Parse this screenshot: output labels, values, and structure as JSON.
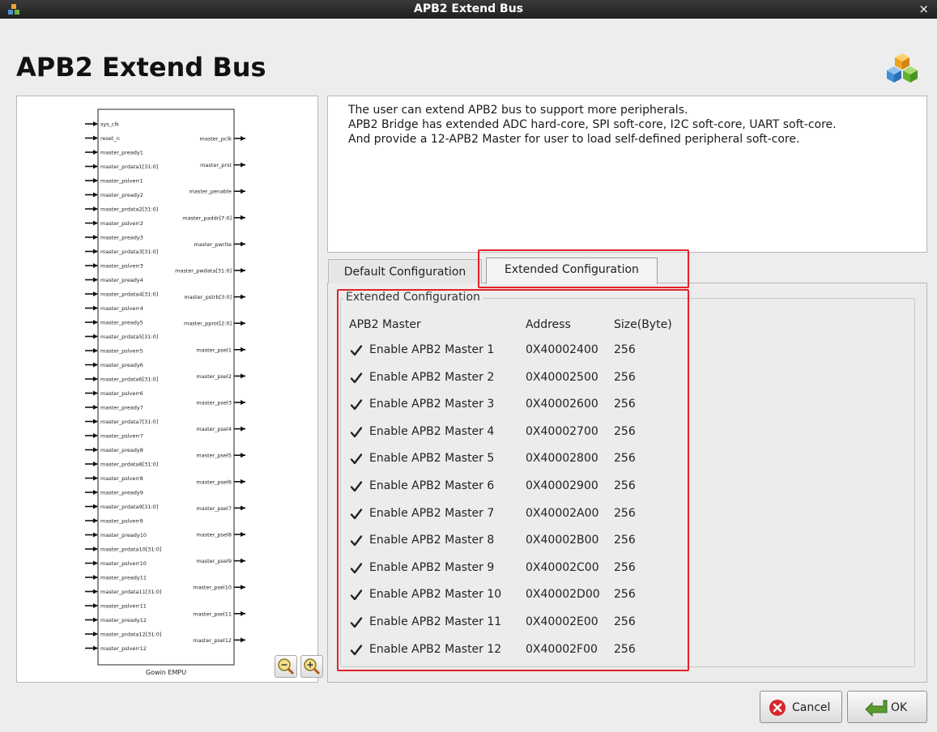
{
  "window": {
    "title": "APB2 Extend Bus",
    "close_glyph": "×"
  },
  "header": {
    "title": "APB2 Extend Bus"
  },
  "diagram": {
    "block_label": "Gowin EMPU",
    "left_pins": [
      "sys_clk",
      "reset_n",
      "master_pready1",
      "master_prdata1[31:0]",
      "master_pslverr1",
      "master_pready2",
      "master_prdata2[31:0]",
      "master_pslverr2",
      "master_pready3",
      "master_prdata3[31:0]",
      "master_pslverr3",
      "master_pready4",
      "master_prdata4[31:0]",
      "master_pslverr4",
      "master_pready5",
      "master_prdata5[31:0]",
      "master_pslverr5",
      "master_pready6",
      "master_prdata6[31:0]",
      "master_pslverr6",
      "master_pready7",
      "master_prdata7[31:0]",
      "master_pslverr7",
      "master_pready8",
      "master_prdata8[31:0]",
      "master_pslverr8",
      "master_pready9",
      "master_prdata9[31:0]",
      "master_pslverr9",
      "master_pready10",
      "master_prdata10[31:0]",
      "master_pslverr10",
      "master_pready11",
      "master_prdata11[31:0]",
      "master_pslverr11",
      "master_pready12",
      "master_prdata12[31:0]",
      "master_pslverr12"
    ],
    "right_pins": [
      "master_pclk",
      "master_prst",
      "master_penable",
      "master_paddr[7:0]",
      "master_pwrite",
      "master_pwdata[31:0]",
      "master_pstrb[3:0]",
      "master_pprot[2:0]",
      "master_psel1",
      "master_psel2",
      "master_psel3",
      "master_psel4",
      "master_psel5",
      "master_psel6",
      "master_psel7",
      "master_psel8",
      "master_psel9",
      "master_psel10",
      "master_psel11",
      "master_psel12"
    ]
  },
  "description": [
    "The user can extend APB2 bus to support more peripherals.",
    "APB2 Bridge has extended ADC hard-core, SPI soft-core, I2C soft-core, UART soft-core.",
    "And provide a 12-APB2 Master for user to load self-defined peripheral soft-core."
  ],
  "tabs": [
    {
      "label": "Default Configuration",
      "selected": false
    },
    {
      "label": "Extended Configuration",
      "selected": true
    }
  ],
  "extended": {
    "group_title": "Extended Configuration",
    "columns": {
      "master": "APB2 Master",
      "address": "Address",
      "size": "Size(Byte)"
    },
    "rows": [
      {
        "label": "Enable APB2 Master 1",
        "checked": true,
        "address": "0X40002400",
        "size": "256"
      },
      {
        "label": "Enable APB2 Master 2",
        "checked": true,
        "address": "0X40002500",
        "size": "256"
      },
      {
        "label": "Enable APB2 Master 3",
        "checked": true,
        "address": "0X40002600",
        "size": "256"
      },
      {
        "label": "Enable APB2 Master 4",
        "checked": true,
        "address": "0X40002700",
        "size": "256"
      },
      {
        "label": "Enable APB2 Master 5",
        "checked": true,
        "address": "0X40002800",
        "size": "256"
      },
      {
        "label": "Enable APB2 Master 6",
        "checked": true,
        "address": "0X40002900",
        "size": "256"
      },
      {
        "label": "Enable APB2 Master 7",
        "checked": true,
        "address": "0X40002A00",
        "size": "256"
      },
      {
        "label": "Enable APB2 Master 8",
        "checked": true,
        "address": "0X40002B00",
        "size": "256"
      },
      {
        "label": "Enable APB2 Master 9",
        "checked": true,
        "address": "0X40002C00",
        "size": "256"
      },
      {
        "label": "Enable APB2 Master 10",
        "checked": true,
        "address": "0X40002D00",
        "size": "256"
      },
      {
        "label": "Enable APB2 Master 11",
        "checked": true,
        "address": "0X40002E00",
        "size": "256"
      },
      {
        "label": "Enable APB2 Master 12",
        "checked": true,
        "address": "0X40002F00",
        "size": "256"
      }
    ]
  },
  "buttons": {
    "cancel_label": "Cancel",
    "ok_label": "OK"
  },
  "colors": {
    "highlight": "#e0232a",
    "titlebar": "#2a2a2a",
    "cancel_icon": "#d8262c",
    "ok_icon": "#5a9a2f"
  }
}
